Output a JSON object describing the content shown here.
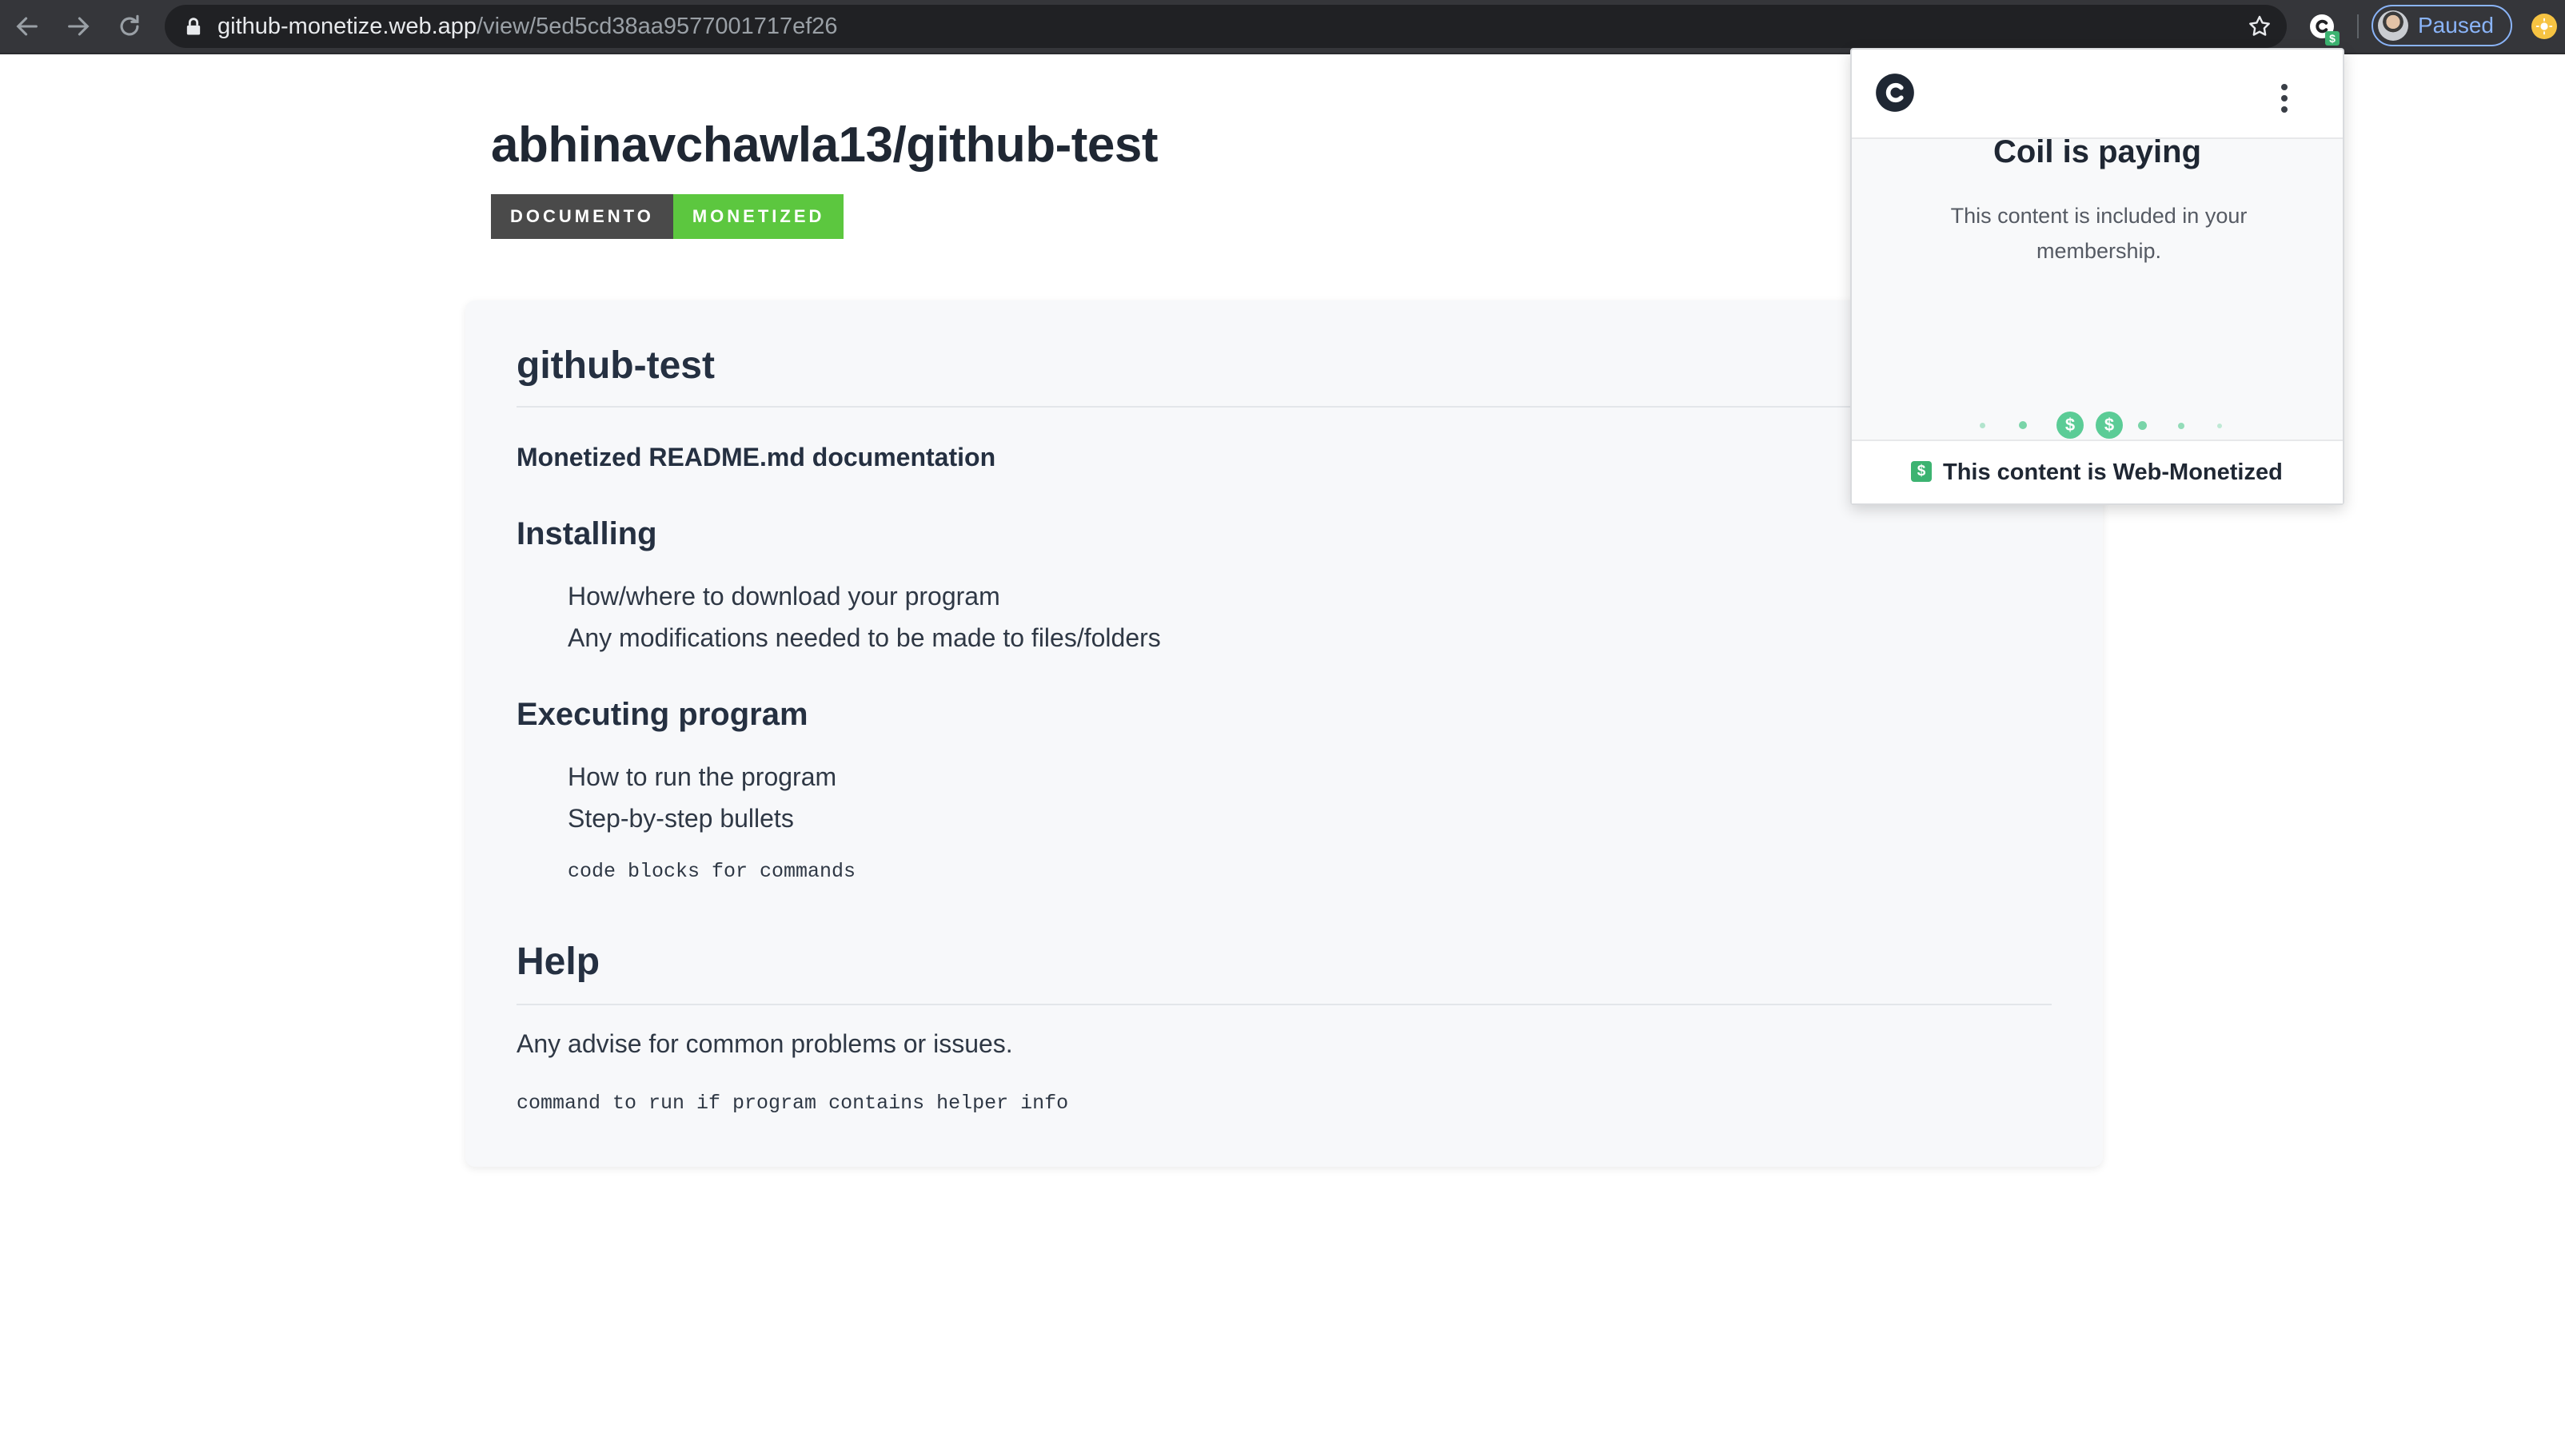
{
  "browser": {
    "url_host": "github-monetize.web.app",
    "url_path": "/view/5ed5cd38aa9577001717ef26",
    "profile_label": "Paused",
    "extension_badge": "$"
  },
  "page": {
    "title": "abhinavchawla13/github-test",
    "tags": [
      "DOCUMENTO",
      "MONETIZED"
    ]
  },
  "readme": {
    "heading": "github-test",
    "subtitle": "Monetized README.md documentation",
    "sections": [
      {
        "heading": "Installing",
        "items": [
          "How/where to download your program",
          "Any modifications needed to be made to files/folders"
        ]
      },
      {
        "heading": "Executing program",
        "items": [
          "How to run the program",
          "Step-by-step bullets"
        ],
        "code": "code blocks for commands"
      }
    ],
    "help": {
      "heading": "Help",
      "text": "Any advise for common problems or issues.",
      "code": "command to run if program contains helper info"
    }
  },
  "coil_popup": {
    "title": "Coil is paying",
    "description": "This content is included in your membership.",
    "dollar_symbol": "$",
    "footer_text": "This content is Web-Monetized"
  },
  "colors": {
    "tag_dark": "#4a4a4a",
    "tag_green": "#5cc73f",
    "coil_green": "#5bcc96",
    "chrome_bg": "#35363a"
  }
}
